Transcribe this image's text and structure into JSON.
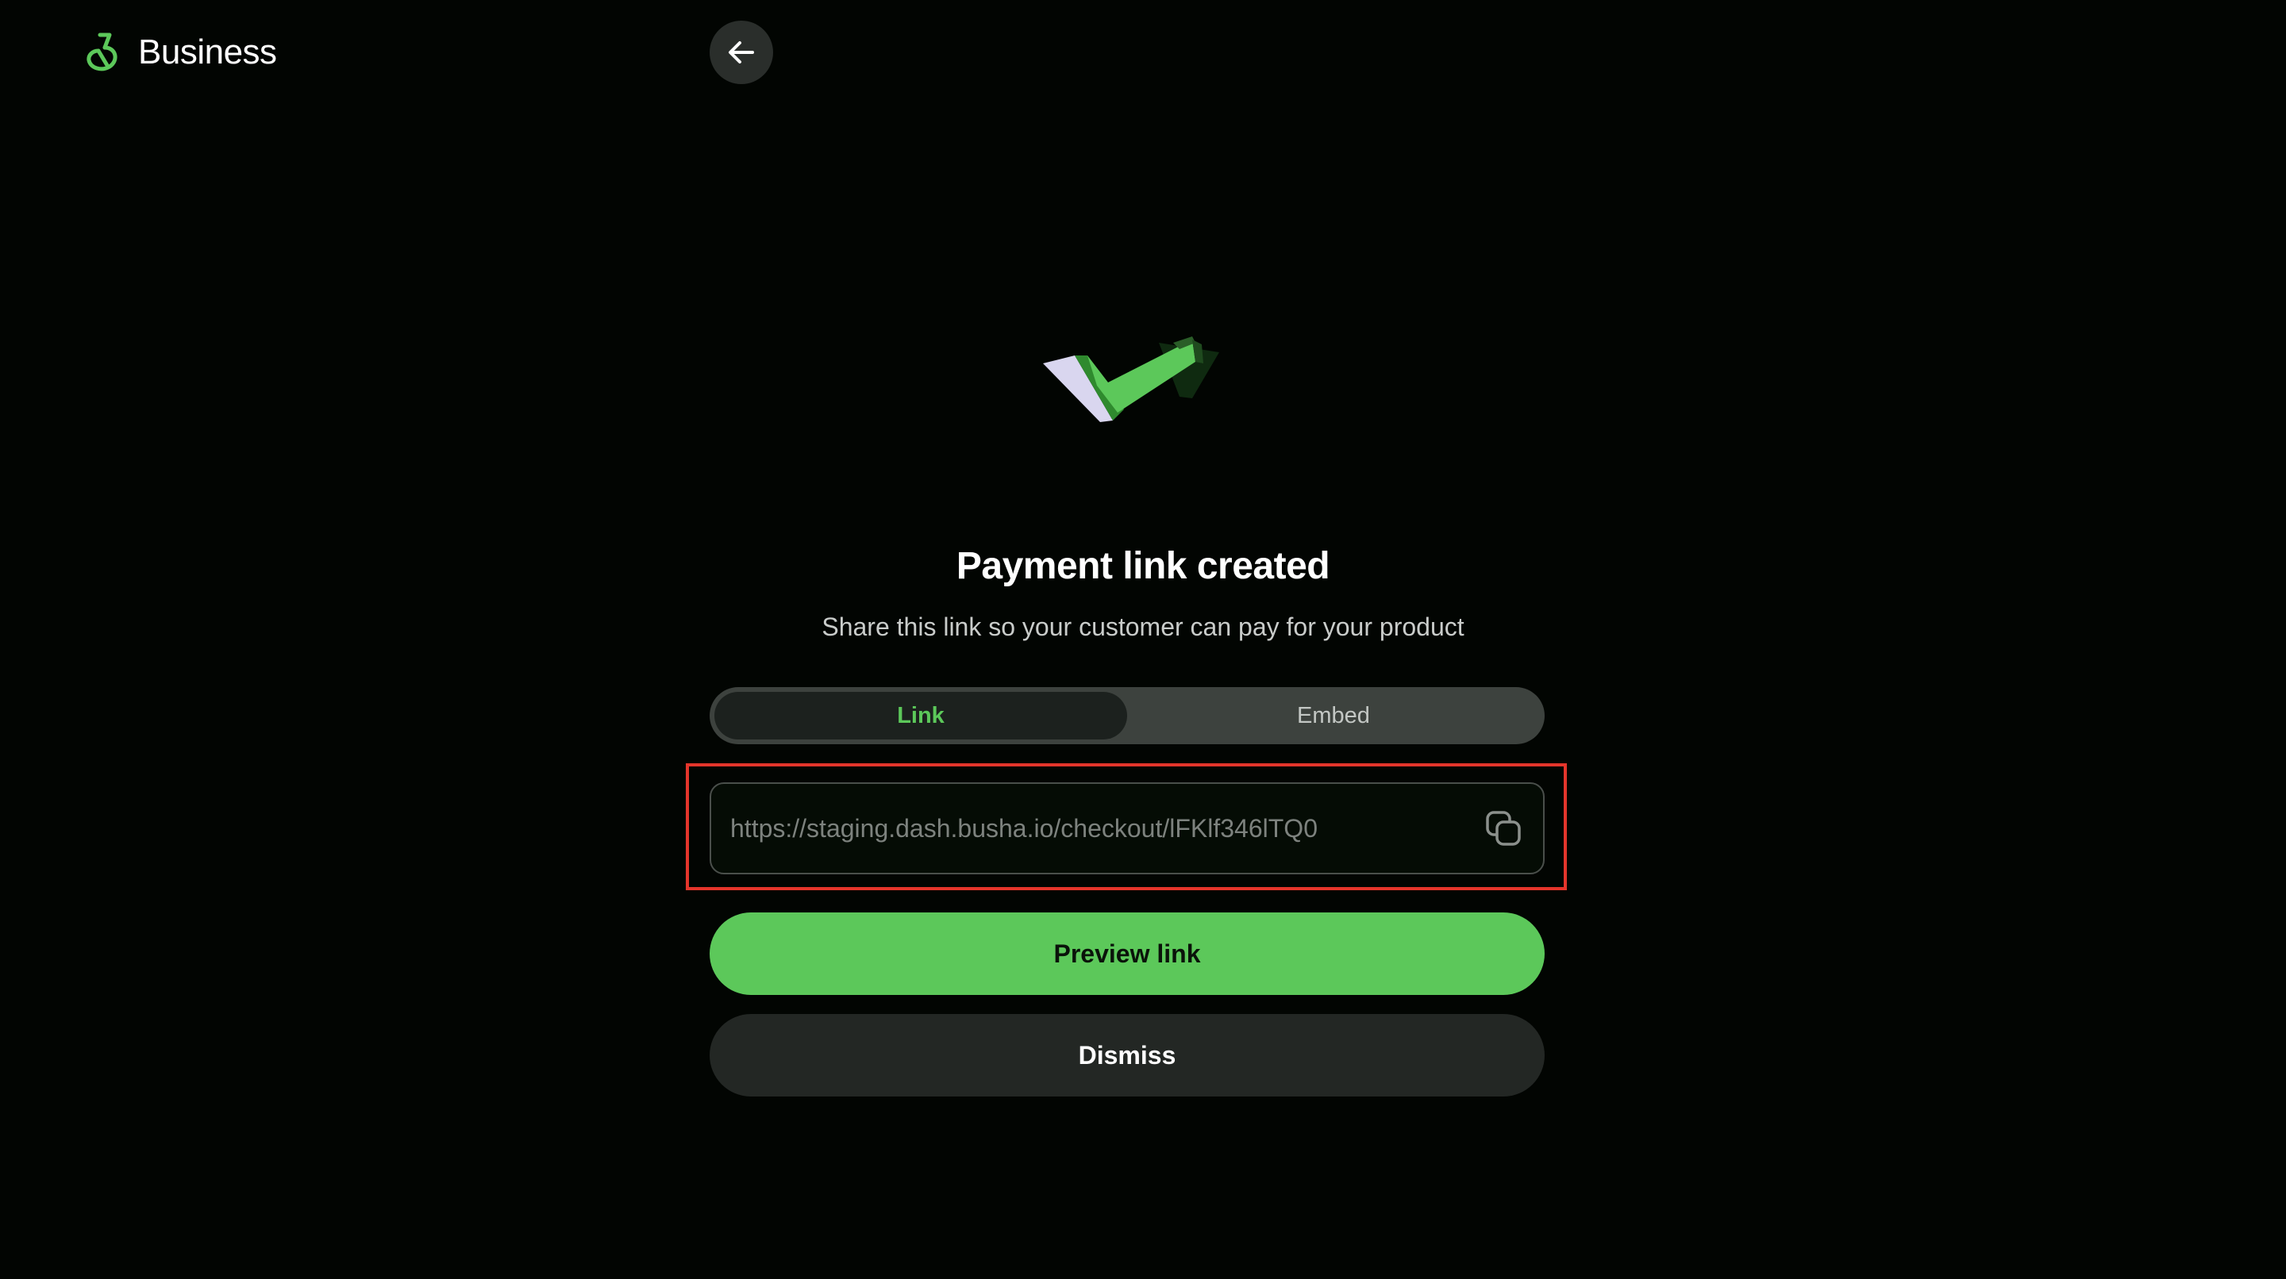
{
  "brand": {
    "name": "Business",
    "logo_icon": "busha-logo-icon",
    "accent_color": "#5cc85a"
  },
  "nav": {
    "back_icon": "arrow-left-icon"
  },
  "illustration": {
    "icon": "checkmark-icon"
  },
  "main": {
    "title": "Payment link created",
    "subtitle": "Share this link so your customer can pay for your product"
  },
  "tabs": {
    "items": [
      {
        "label": "Link",
        "active": true
      },
      {
        "label": "Embed",
        "active": false
      }
    ]
  },
  "link": {
    "url": "https://staging.dash.busha.io/checkout/lFKlf346lTQ0",
    "copy_icon": "copy-icon"
  },
  "actions": {
    "preview_label": "Preview link",
    "dismiss_label": "Dismiss"
  },
  "highlight": {
    "color": "#e4352b"
  }
}
